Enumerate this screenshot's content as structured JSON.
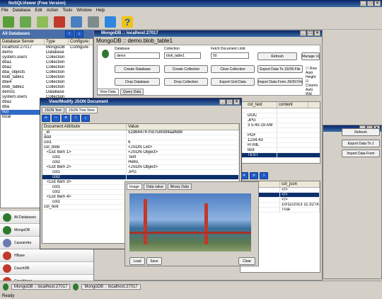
{
  "app": {
    "title": "NoSQLViewer (Free Version)",
    "menu": [
      "File",
      "Database",
      "Edit",
      "Action",
      "Tools",
      "Window",
      "Help"
    ],
    "toolbar_icons": [
      "connect-icon",
      "disconnect-icon",
      "add-icon",
      "tools-icon",
      "delete-icon",
      "search-icon",
      "zoom-icon",
      "export-icon",
      "help-icon"
    ]
  },
  "sidebar": {
    "title": "All Databases",
    "columns": [
      "Database Server",
      "Type",
      "Configure"
    ],
    "rows": [
      {
        "name": "localhost:27017",
        "type": "MongoDB",
        "conf": "Configure DB"
      },
      {
        "name": "demo",
        "type": "Database",
        "conf": ""
      },
      {
        "name": "system.users",
        "type": "Collection",
        "conf": ""
      },
      {
        "name": "dba1",
        "type": "Collection",
        "conf": ""
      },
      {
        "name": "dba2",
        "type": "Collection",
        "conf": ""
      },
      {
        "name": "dba_objects",
        "type": "Collection",
        "conf": ""
      },
      {
        "name": "blob_table1",
        "type": "Collection",
        "conf": ""
      },
      {
        "name": "dbe4",
        "type": "Collection",
        "conf": ""
      },
      {
        "name": "blob_table2",
        "type": "Collection",
        "conf": ""
      },
      {
        "name": "demo1",
        "type": "Database",
        "conf": ""
      },
      {
        "name": "system.users",
        "type": "Collection",
        "conf": ""
      },
      {
        "name": "dba2",
        "type": "Collection",
        "conf": ""
      },
      {
        "name": "dba",
        "type": "Collection",
        "conf": ""
      },
      {
        "name": "fico",
        "type": "Collection",
        "conf": ""
      },
      {
        "name": "local",
        "type": "Database",
        "conf": ""
      }
    ],
    "db_types": [
      "All Databases",
      "MongoDB",
      "Cassandra",
      "HBase",
      "CouchDB",
      "Couchbase"
    ]
  },
  "mongo_window": {
    "title": "MongoDB :: localhost:27017",
    "heading": "MongoDB :: demo.blob_table1",
    "database_label": "Database",
    "database_value": "demo",
    "collection_label": "Collection",
    "collection_value": "blob_table1",
    "fetch_label": "Fetch Document Limit",
    "fetch_value": "50",
    "buttons": {
      "refresh": "Refresh",
      "manage_users": "Manage Users",
      "create_db": "Create Database",
      "create_coll": "Create Collection",
      "clear_coll": "Clear Collection",
      "export_json": "Export Data To JSON File",
      "drop_db": "Drop Database",
      "drop_coll": "Drop Collection",
      "export_grid": "Export Grid Data",
      "import_json": "Import Data From JSON File"
    },
    "row_auto_height": "Row Auto Height",
    "column_auto_width": "Column Auto Wid",
    "tabs": [
      "View Data",
      "Query Data"
    ],
    "grid_columns": [
      "col_text",
      "content"
    ],
    "grid_rows": [
      "",
      "DOC",
      "JPG",
      "3 5:45:19 AM",
      "",
      "PDF",
      "1234.43",
      "HTML",
      "test",
      "TEST"
    ],
    "lower_columns": [
      "col_text",
      "col_json"
    ],
    "lower_rows": [
      {
        "a": "{",
        "b": "</>"
      },
      {
        "a": "{",
        "b": "</>"
      },
      {
        "a": "{",
        "b": "</>"
      },
      {
        "a": "{",
        "b": "10/11/2013 11:32:00 AM"
      },
      {
        "a": "{",
        "b": "True"
      }
    ]
  },
  "right_window": {
    "refresh": "Refresh",
    "export": "Export Data To J",
    "import": "Import Data From"
  },
  "json_window": {
    "title": "View/Modify JSON Document",
    "tabs": [
      "JSON Text",
      "JSON Tree View"
    ],
    "columns": [
      "Document Attribute",
      "Value"
    ],
    "rows": [
      {
        "k": "_id",
        "v": "52d6447470d7580df4aaf688"
      },
      {
        "k": "ddd",
        "v": ""
      },
      {
        "k": "col1",
        "v": "6"
      },
      {
        "k": "col_blob",
        "v": "<JSON List>"
      },
      {
        "k": "<List Item 1>",
        "v": "<JSON Object>"
      },
      {
        "k": "col1",
        "v": "Text"
      },
      {
        "k": "col2",
        "v": "Hello,"
      },
      {
        "k": "<List Item 2>",
        "v": "<JSON Object>"
      },
      {
        "k": "col1",
        "v": "JPG"
      },
      {
        "k": "col2",
        "v": ""
      },
      {
        "k": "<List Item 3>",
        "v": ""
      },
      {
        "k": "col1",
        "v": ""
      },
      {
        "k": "col2",
        "v": ""
      },
      {
        "k": "<List Item 4>",
        "v": ""
      },
      {
        "k": "col1",
        "v": ""
      },
      {
        "k": "col_text",
        "v": ""
      }
    ]
  },
  "image_window": {
    "tabs": [
      "Image",
      "Data value",
      "Binary Data"
    ],
    "load": "Load",
    "save": "Save",
    "clear": "Clear"
  },
  "status": {
    "tab1": "MongoDB :: localhost:27017",
    "tab2": "MongoDB :: localhost:27017",
    "text": "Ready"
  }
}
